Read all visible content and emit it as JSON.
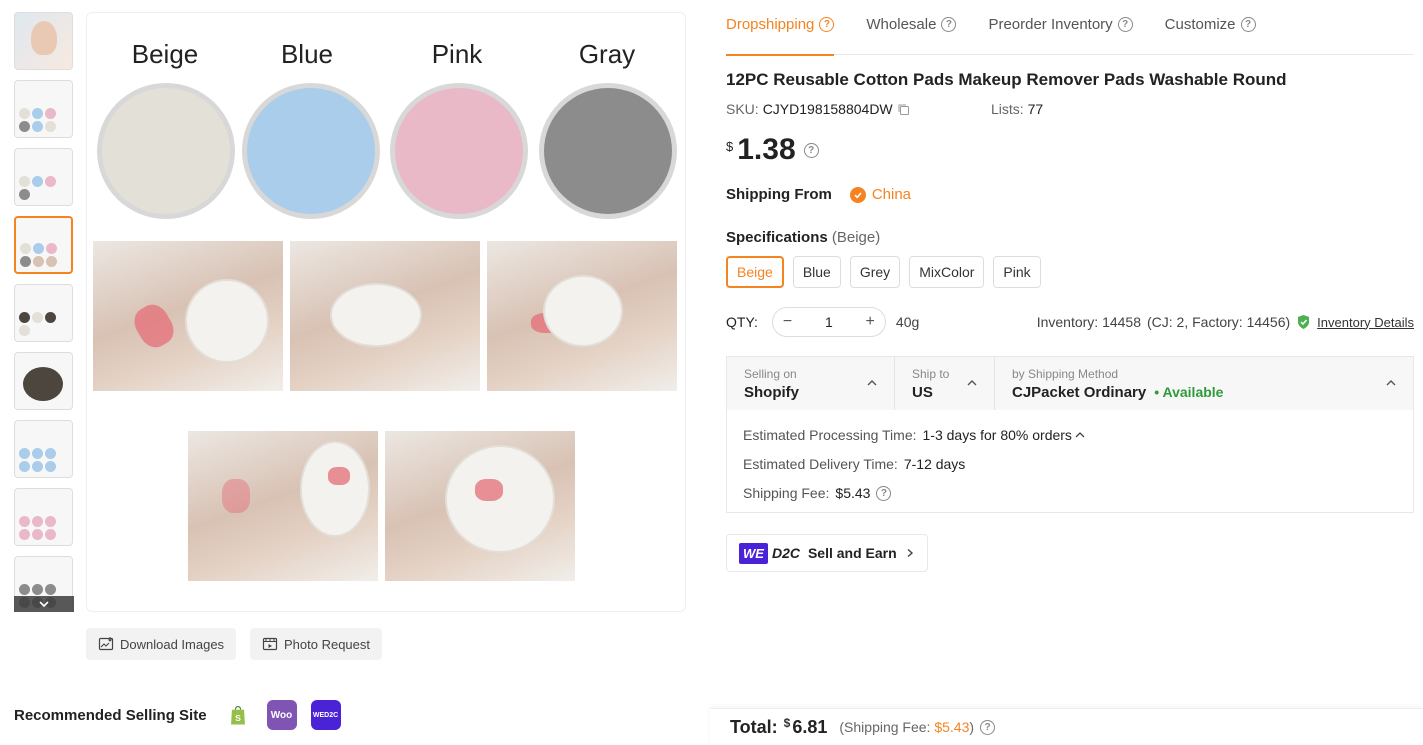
{
  "gallery": {
    "swatches": [
      {
        "label": "Beige",
        "color": "#e3e0d8"
      },
      {
        "label": "Blue",
        "color": "#a9cdea"
      },
      {
        "label": "Pink",
        "color": "#eab9c7"
      },
      {
        "label": "Gray",
        "color": "#8c8c8c"
      }
    ],
    "thumbnail_count": 9,
    "active_thumbnail": 4,
    "download_label": "Download Images",
    "photo_request_label": "Photo Request"
  },
  "recommended": {
    "title": "Recommended Selling Site",
    "sites": [
      {
        "name": "shopify-icon",
        "text": "S",
        "color": "#95bf47"
      },
      {
        "name": "woocommerce-icon",
        "text": "Woo",
        "color": "#7f54b3"
      },
      {
        "name": "wed2c-icon",
        "text": "WED2C",
        "color": "#4b23d6"
      }
    ]
  },
  "tabs": [
    {
      "label": "Dropshipping",
      "active": true
    },
    {
      "label": "Wholesale",
      "active": false
    },
    {
      "label": "Preorder Inventory",
      "active": false
    },
    {
      "label": "Customize",
      "active": false
    }
  ],
  "product": {
    "title": "12PC Reusable Cotton Pads Makeup Remover Pads Washable Round",
    "sku_label": "SKU:",
    "sku": "CJYD198158804DW",
    "lists_label": "Lists:",
    "lists": "77",
    "currency": "$",
    "price": "1.38"
  },
  "shipping_from": {
    "label": "Shipping From",
    "value": "China"
  },
  "specs": {
    "label": "Specifications",
    "selected": "(Beige)",
    "options": [
      "Beige",
      "Blue",
      "Grey",
      "MixColor",
      "Pink"
    ],
    "active_index": 0
  },
  "qty": {
    "label": "QTY:",
    "minus": "−",
    "plus": "+",
    "value": "1",
    "weight": "40g",
    "inventory": "Inventory: 14458",
    "inventory_breakdown": "(CJ: 2, Factory: 14456)",
    "inventory_link": "Inventory Details"
  },
  "shipping": {
    "selling_on_label": "Selling on",
    "selling_on": "Shopify",
    "ship_to_label": "Ship to",
    "ship_to": "US",
    "method_label": "by Shipping Method",
    "method": "CJPacket Ordinary",
    "availability": "• Available",
    "processing_label": "Estimated Processing Time:",
    "processing": "1-3 days for 80% orders",
    "delivery_label": "Estimated Delivery Time:",
    "delivery": "7-12 days",
    "fee_label": "Shipping Fee:",
    "fee": "$5.43"
  },
  "d2c": {
    "we": "WE",
    "d2c": "D2C",
    "label": "Sell and Earn"
  },
  "total": {
    "label": "Total:",
    "currency": "$",
    "value": "6.81",
    "fee_prefix": "(Shipping Fee:",
    "fee": "$5.43",
    "fee_suffix": ")"
  },
  "colors": {
    "accent": "#f5831f",
    "available": "#2e9a3a"
  }
}
